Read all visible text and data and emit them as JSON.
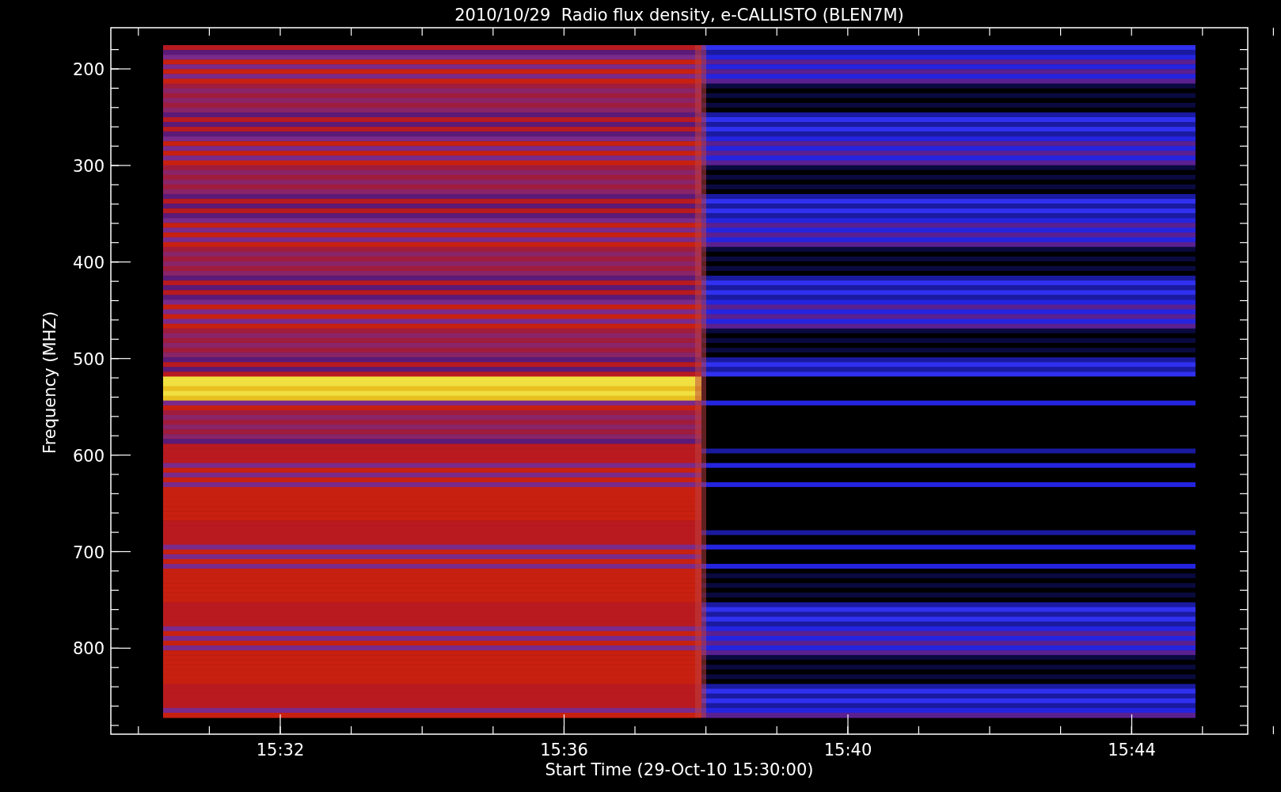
{
  "title": "2010/10/29  Radio flux density, e-CALLISTO (BLEN7M)",
  "y_axis": {
    "label": "Frequency (MHZ)",
    "ticks": [
      "200",
      "300",
      "400",
      "500",
      "600",
      "700",
      "800"
    ]
  },
  "x_axis": {
    "label": "Start Time (29-Oct-10 15:30:00)",
    "ticks": [
      "15:32",
      "15:36",
      "15:40",
      "15:44"
    ]
  }
}
